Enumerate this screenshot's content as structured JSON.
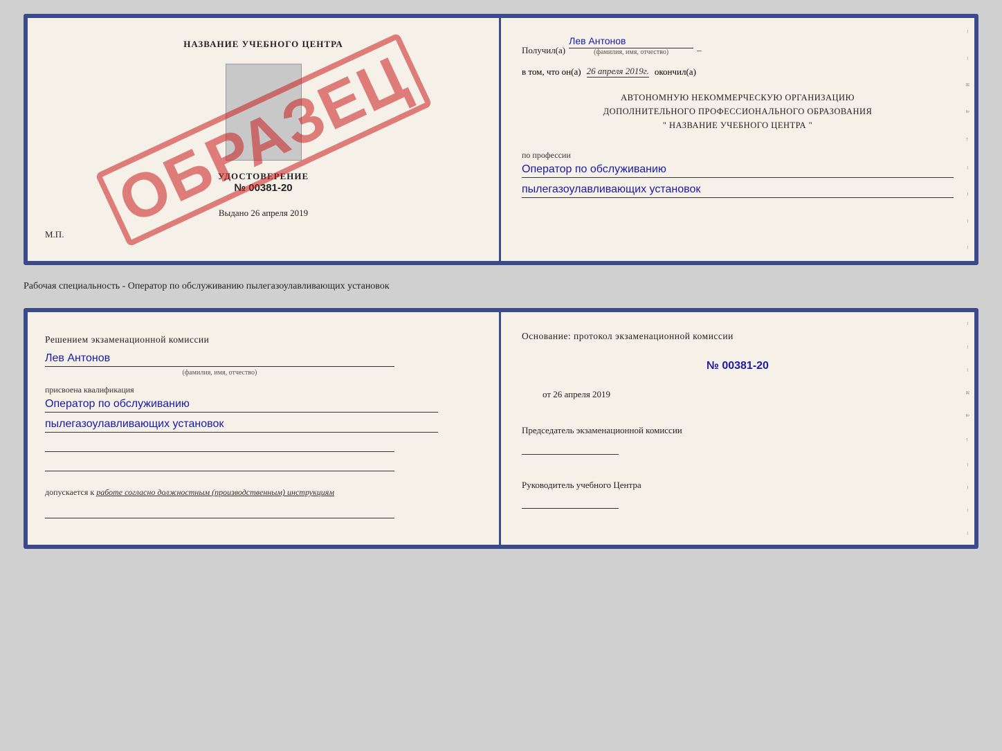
{
  "top_document": {
    "left": {
      "title": "НАЗВАНИЕ УЧЕБНОГО ЦЕНТРА",
      "stamp": "ОБРАЗЕЦ",
      "udostoverenie_label": "УДОСТОВЕРЕНИЕ",
      "number": "№ 00381-20",
      "vydano_label": "Выдано",
      "vydano_date": "26 апреля 2019",
      "mp": "М.П."
    },
    "right": {
      "poluchil_label": "Получил(а)",
      "poluchil_value": "Лев Антонов",
      "fio_subtitle": "(фамилия, имя, отчество)",
      "dash": "–",
      "v_tom_chto": "в том, что он(а)",
      "date_value": "26 апреля 2019г.",
      "okoncil": "окончил(а)",
      "org_line1": "АВТОНОМНУЮ НЕКОММЕРЧЕСКУЮ ОРГАНИЗАЦИЮ",
      "org_line2": "ДОПОЛНИТЕЛЬНОГО ПРОФЕССИОНАЛЬНОГО ОБРАЗОВАНИЯ",
      "org_line3": "\"   НАЗВАНИЕ УЧЕБНОГО ЦЕНТРА   \"",
      "po_professii": "по профессии",
      "profession_line1": "Оператор по обслуживанию",
      "profession_line2": "пылегазоулавливающих установок"
    }
  },
  "middle_text": "Рабочая специальность - Оператор по обслуживанию пылегазоулавливающих установок",
  "bottom_document": {
    "left": {
      "resheniye": "Решением экзаменационной комиссии",
      "name_value": "Лев Антонов",
      "fio_subtitle": "(фамилия, имя, отчество)",
      "prisvoena": "присвоена квалификация",
      "qual_line1": "Оператор по обслуживанию",
      "qual_line2": "пылегазоулавливающих установок",
      "dopuskaetsya": "допускается к",
      "dopusk_value": "работе согласно должностным (производственным) инструкциям"
    },
    "right": {
      "osnovaniye": "Основание: протокол экзаменационной комиссии",
      "protocol_number": "№ 00381-20",
      "ot_label": "от",
      "ot_date": "26 апреля 2019",
      "chairman_label": "Председатель экзаменационной комиссии",
      "rukovoditel_label": "Руководитель учебного Центра"
    }
  }
}
